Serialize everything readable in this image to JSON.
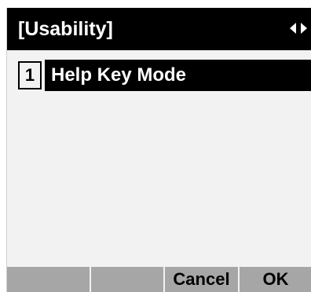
{
  "header": {
    "title": "[Usability]",
    "nav_arrows_icon": "left-right-arrows-icon"
  },
  "menu": {
    "items": [
      {
        "number": "1",
        "label": "Help Key Mode",
        "selected": true
      }
    ]
  },
  "softkeys": {
    "key1": "",
    "key2": "",
    "key3": "Cancel",
    "key4": "OK"
  },
  "colors": {
    "title_bg": "#000000",
    "title_fg": "#ffffff",
    "screen_bg": "#f2f2f2",
    "softkey_bg": "#a6a6a6"
  }
}
